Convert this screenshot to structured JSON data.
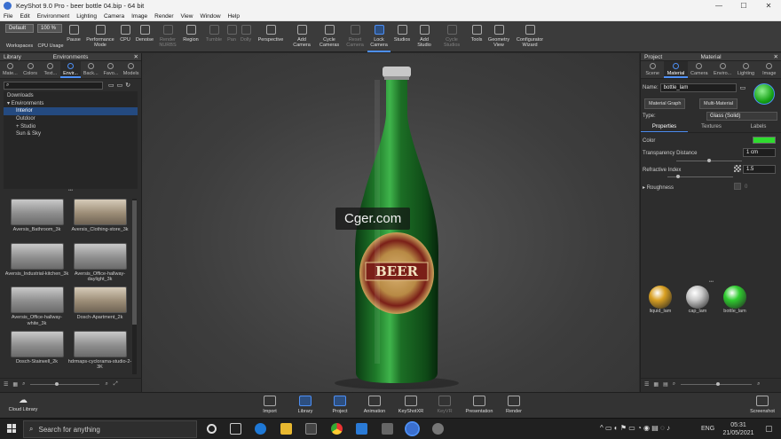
{
  "window": {
    "title": "KeyShot 9.0 Pro  -  beer bottle 04.bip  -  64 bit",
    "minimize": "—",
    "maximize": "☐",
    "close": "✕"
  },
  "menu": [
    "File",
    "Edit",
    "Environment",
    "Lighting",
    "Camera",
    "Image",
    "Render",
    "View",
    "Window",
    "Help"
  ],
  "ribbon": {
    "workspace_select": "Default",
    "cpu_select": "100 %",
    "buttons": [
      {
        "label": "Workspaces",
        "dim": false
      },
      {
        "label": "CPU Usage",
        "dim": false
      },
      {
        "label": "Pause",
        "dim": false
      },
      {
        "label": "Performance Mode",
        "dim": false
      },
      {
        "label": "CPU",
        "dim": false
      },
      {
        "label": "Denoise",
        "dim": false
      },
      {
        "label": "Render NURBS",
        "dim": true
      },
      {
        "label": "Region",
        "dim": false
      },
      {
        "label": "Tumble",
        "dim": true
      },
      {
        "label": "Pan",
        "dim": true
      },
      {
        "label": "Dolly",
        "dim": true
      },
      {
        "label": "Perspective",
        "dim": false
      },
      {
        "label": "Add Camera",
        "dim": false
      },
      {
        "label": "Cycle Cameras",
        "dim": false
      },
      {
        "label": "Reset Camera",
        "dim": true
      },
      {
        "label": "Lock Camera",
        "dim": false,
        "active": true
      },
      {
        "label": "Studios",
        "dim": false
      },
      {
        "label": "Add Studio",
        "dim": false
      },
      {
        "label": "Cycle Studios",
        "dim": true
      },
      {
        "label": "Tools",
        "dim": false
      },
      {
        "label": "Geometry View",
        "dim": false
      },
      {
        "label": "Configurator Wizard",
        "dim": false
      }
    ]
  },
  "library": {
    "header": "Library",
    "section": "Environments",
    "tabs": [
      "Mate...",
      "Colors",
      "Text...",
      "Envir...",
      "Back...",
      "Favo...",
      "Models"
    ],
    "active_tab": 3,
    "tree": [
      {
        "label": "Downloads",
        "indent": 0
      },
      {
        "label": "Environments",
        "indent": 0
      },
      {
        "label": "Interior",
        "indent": 1,
        "selected": true
      },
      {
        "label": "Outdoor",
        "indent": 1
      },
      {
        "label": "Studio",
        "indent": 1
      },
      {
        "label": "Sun & Sky",
        "indent": 1
      }
    ],
    "thumbnails": [
      {
        "label": "Aversis_Bathroom_3k",
        "warm": false
      },
      {
        "label": "Aversis_Clothing-store_3k",
        "warm": true
      },
      {
        "label": "Aversis_Industrial-kitchen_3k",
        "warm": false
      },
      {
        "label": "Aversis_Office-hallway-daylight_3k",
        "warm": false
      },
      {
        "label": "Aversis_Office-hallway-white_3k",
        "warm": false
      },
      {
        "label": "Dosch-Apartment_2k",
        "warm": true
      },
      {
        "label": "Dosch-Stairwell_2k",
        "warm": false
      },
      {
        "label": "hdrmaps-cyclorama-studio-2-3K",
        "warm": false
      }
    ]
  },
  "viewport": {
    "watermark": "Cger.com",
    "label_text": "BEER"
  },
  "right_panel": {
    "header_left": "Project",
    "header_center": "Material",
    "tabs": [
      "Scene",
      "Material",
      "Camera",
      "Enviro...",
      "Lighting",
      "Image"
    ],
    "active_tab": 1,
    "name_label": "Name:",
    "name_value": "bottle_lam",
    "material_graph": "Material Graph",
    "multi_material": "Multi-Material",
    "type_label": "Type:",
    "type_value": "Glass (Solid)",
    "subtabs": [
      "Properties",
      "Textures",
      "Labels"
    ],
    "color_label": "Color",
    "color_value": "#2fdc2f",
    "transparency_label": "Transparency Distance",
    "transparency_value": "1 cm",
    "refractive_label": "Refractive Index",
    "refractive_value": "1.5",
    "roughness_label": "Roughness",
    "roughness_value": "0",
    "materials": [
      {
        "label": "liquid_lam",
        "color": "#d9a022"
      },
      {
        "label": "cap_lam",
        "color": "#c8c8c8"
      },
      {
        "label": "bottle_lam",
        "color": "#2fcc2f"
      }
    ]
  },
  "bottombar": {
    "cloud": "Cloud Library",
    "buttons": [
      {
        "label": "Import",
        "dim": false
      },
      {
        "label": "Library",
        "dim": false,
        "active": true
      },
      {
        "label": "Project",
        "dim": false,
        "active": true
      },
      {
        "label": "Animation",
        "dim": false
      },
      {
        "label": "KeyShotXR",
        "dim": false
      },
      {
        "label": "KeyVR",
        "dim": true
      },
      {
        "label": "Presentation",
        "dim": false
      },
      {
        "label": "Render",
        "dim": false
      }
    ],
    "screenshot": "Screenshot"
  },
  "taskbar": {
    "search": "Search for anything",
    "lang": "ENG",
    "time": "05:31",
    "date": "21/05/2021"
  }
}
